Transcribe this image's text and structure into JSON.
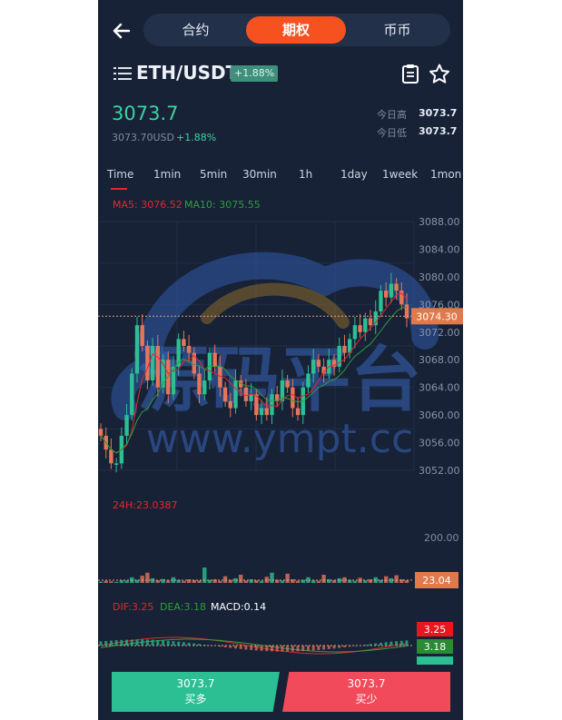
{
  "header": {
    "tabs": [
      {
        "label": "合约",
        "active": false
      },
      {
        "label": "期权",
        "active": true
      },
      {
        "label": "币币",
        "active": false
      }
    ]
  },
  "ticker": {
    "pair": "ETH/USDT",
    "change_badge": "+1.88%",
    "price": "3073.7",
    "price_usd": "3073.70USD",
    "change": "+1.88%",
    "high_label": "今日高",
    "high_value": "3073.7",
    "low_label": "今日低",
    "low_value": "3073.7"
  },
  "timeframes": [
    "Time",
    "1min",
    "5min",
    "30min",
    "1h",
    "1day",
    "1week",
    "1mon"
  ],
  "indicators": {
    "ma5": "MA5: 3076.52",
    "ma10": "MA10: 3075.55",
    "vol": "24H:23.0387",
    "dif": "DIF:3.25",
    "dea": "DEA:3.18",
    "macd": "MACD:0.14"
  },
  "watermark": {
    "line1": "源码平台",
    "line2": "www.ympt.cc"
  },
  "chart_data": [
    {
      "type": "candlestick",
      "y_ticks": [
        "3088.00",
        "3084.00",
        "3080.00",
        "3076.00",
        "3072.00",
        "3068.00",
        "3064.00",
        "3060.00",
        "3056.00",
        "3052.00"
      ],
      "ylim": [
        3052,
        3088
      ],
      "last_price_label": "3074.30",
      "last_price": 3074.3,
      "ma5": "MA5: 3076.52",
      "ma10": "MA10: 3075.55",
      "candles_close": [
        3057,
        3055,
        3053,
        3053,
        3057,
        3060,
        3066,
        3073,
        3070,
        3065,
        3070,
        3064,
        3068,
        3063,
        3067,
        3071,
        3070,
        3069,
        3066,
        3063,
        3065,
        3069,
        3067,
        3064,
        3062,
        3061,
        3065,
        3064,
        3062,
        3063,
        3060,
        3061,
        3060,
        3063,
        3062,
        3065,
        3064,
        3061,
        3060,
        3064,
        3066,
        3068,
        3067,
        3066,
        3068,
        3067,
        3070,
        3069,
        3071,
        3073,
        3072,
        3074,
        3073,
        3075,
        3078,
        3077,
        3079,
        3078,
        3076,
        3074
      ]
    },
    {
      "type": "bar",
      "title": "24H:23.0387",
      "y_ticks": [
        "200.00"
      ],
      "last_value_label": "23.04",
      "values": [
        5,
        8,
        6,
        4,
        10,
        9,
        22,
        12,
        28,
        40,
        18,
        10,
        15,
        9,
        22,
        12,
        8,
        14,
        11,
        9,
        60,
        12,
        14,
        8,
        26,
        12,
        18,
        32,
        9,
        14,
        10,
        8,
        24,
        40,
        12,
        9,
        36,
        14,
        8,
        12,
        22,
        10,
        8,
        32,
        14,
        10,
        18,
        22,
        12,
        8,
        20,
        10,
        14,
        22,
        12,
        26,
        18,
        30,
        14,
        10
      ],
      "ymax": 220
    },
    {
      "type": "line",
      "series": [
        {
          "name": "DIF:3.25"
        },
        {
          "name": "DEA:3.18"
        },
        {
          "name": "MACD:0.14"
        }
      ],
      "badges": [
        "3.25",
        "3.18"
      ]
    }
  ],
  "footer": {
    "buy": {
      "price": "3073.7",
      "label": "买多"
    },
    "sell": {
      "price": "3073.7",
      "label": "买少"
    }
  },
  "colors": {
    "up": "#2bbf93",
    "down": "#f04a5b",
    "accent": "#f5521f",
    "bg": "#172237"
  }
}
